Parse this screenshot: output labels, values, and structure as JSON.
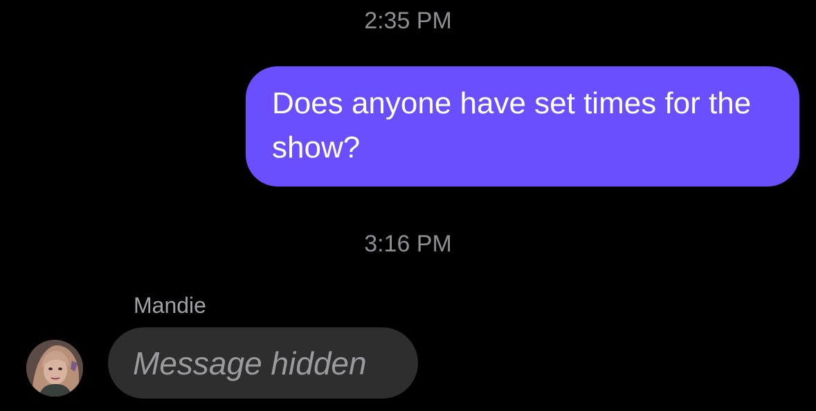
{
  "theme": {
    "accent": "#6a4ffe",
    "background": "#000000",
    "incoming_bubble": "#2e2e2e"
  },
  "messages": [
    {
      "timestamp": "2:35 PM",
      "direction": "outgoing",
      "text": "Does anyone have set times for the show?"
    },
    {
      "timestamp": "3:16 PM",
      "direction": "incoming",
      "sender": "Mandie",
      "text": "Message hidden",
      "avatar_icon": "user-avatar-photo"
    }
  ]
}
